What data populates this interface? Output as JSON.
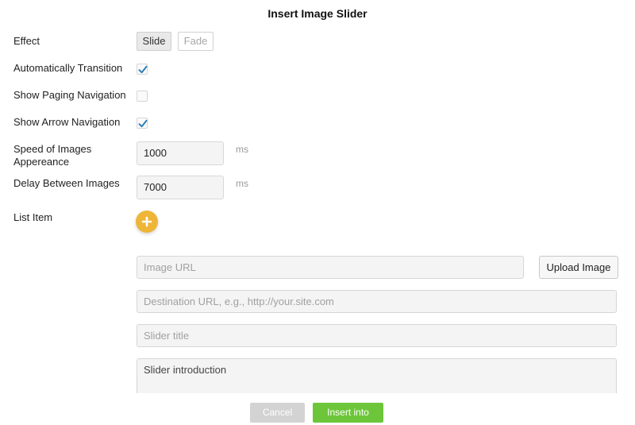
{
  "dialog": {
    "title": "Insert Image Slider"
  },
  "effect": {
    "label": "Effect",
    "options": [
      "Slide",
      "Fade"
    ],
    "selected": "Slide"
  },
  "auto_transition": {
    "label": "Automatically Transition",
    "checked": true
  },
  "paging_nav": {
    "label": "Show Paging Navigation",
    "checked": false
  },
  "arrow_nav": {
    "label": "Show Arrow Navigation",
    "checked": true
  },
  "speed": {
    "label_line1": "Speed of Images",
    "label_line2": "Appereance",
    "value": "1000",
    "unit": "ms"
  },
  "delay": {
    "label": "Delay Between Images",
    "value": "7000",
    "unit": "ms"
  },
  "list_item": {
    "label": "List Item",
    "add_icon": "plus-icon"
  },
  "slide_form": {
    "image_url_placeholder": "Image URL",
    "upload_label": "Upload Image",
    "destination_placeholder": "Destination URL, e.g., http://your.site.com",
    "title_placeholder": "Slider title",
    "intro_placeholder": "Slider introduction"
  },
  "footer": {
    "cancel_label": "Cancel",
    "insert_label": "Insert into"
  },
  "colors": {
    "accent_green": "#6dc63a",
    "add_yellow": "#efb537",
    "check_blue": "#2a7fb8"
  }
}
